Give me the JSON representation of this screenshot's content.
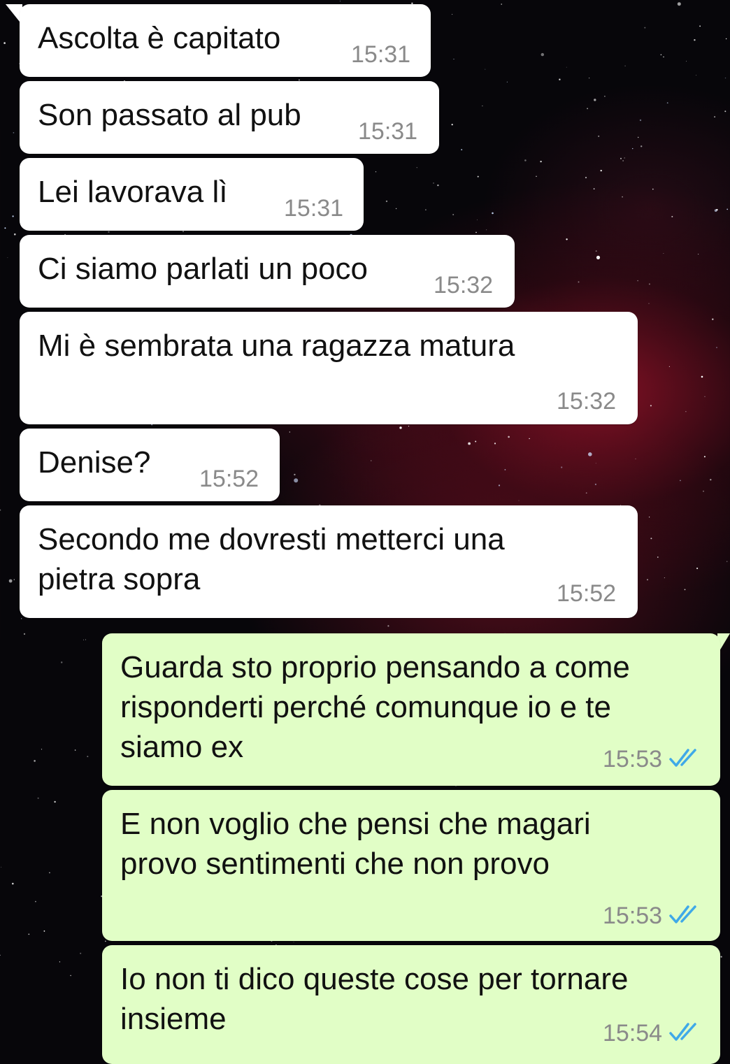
{
  "colors": {
    "incoming_bubble": "#ffffff",
    "outgoing_bubble": "#e1fec6",
    "timestamp": "#8a8a8a",
    "read_ticks": "#3fa9e8"
  },
  "messages": [
    {
      "direction": "incoming",
      "text": "Ascolta è capitato",
      "time": "15:31"
    },
    {
      "direction": "incoming",
      "text": "Son passato al pub",
      "time": "15:31"
    },
    {
      "direction": "incoming",
      "text": "Lei lavorava lì",
      "time": "15:31"
    },
    {
      "direction": "incoming",
      "text": "Ci siamo parlati un poco",
      "time": "15:32"
    },
    {
      "direction": "incoming",
      "text": "Mi è sembrata una ragazza matura",
      "time": "15:32"
    },
    {
      "direction": "incoming",
      "text": "Denise?",
      "time": "15:52"
    },
    {
      "direction": "incoming",
      "text": "Secondo me dovresti metterci una\npietra sopra",
      "time": "15:52"
    },
    {
      "direction": "outgoing",
      "text": "Guarda sto proprio pensando a come\nrisponderti perché comunque io e te\nsiamo ex",
      "time": "15:53",
      "status_icon": "double-check-read-icon"
    },
    {
      "direction": "outgoing",
      "text": "E non voglio che pensi che magari\nprovo sentimenti che non provo",
      "time": "15:53",
      "status_icon": "double-check-read-icon"
    },
    {
      "direction": "outgoing",
      "text": "Io non ti dico queste cose per tornare\ninsieme",
      "time": "15:54",
      "status_icon": "double-check-read-icon"
    }
  ]
}
